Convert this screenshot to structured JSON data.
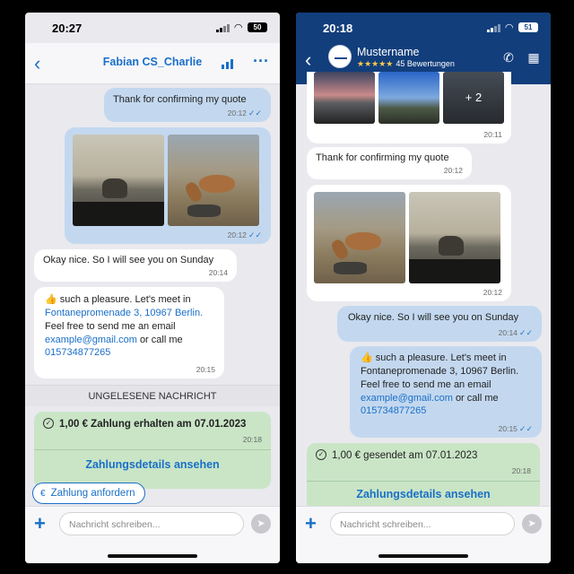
{
  "left": {
    "status_time": "20:27",
    "battery": "50",
    "header": {
      "title": "Fabian CS_Charlie"
    },
    "messages": {
      "m1": {
        "text": "Thank for confirming my quote",
        "time": "20:12"
      },
      "photos_time": "20:12",
      "m2": {
        "text": "Okay nice. So I will see you on Sunday",
        "time": "20:14"
      },
      "m3": {
        "emoji": "👍",
        "line1": "such a pleasure. Let's meet in",
        "address": "Fontanepromenade 3, 10967 Berlin.",
        "line2": "Feel free to send me an email",
        "email": "example@gmail.com",
        "or_call": "or call me",
        "phone": "015734877265",
        "time": "20:15"
      }
    },
    "unread_label": "UNGELESENE NACHRICHT",
    "payment": {
      "title": "1,00 € Zahlung erhalten am 07.01.2023",
      "time": "20:18",
      "link": "Zahlungsdetails ansehen"
    },
    "request_button": {
      "symbol": "€",
      "label": "Zahlung anfordern"
    },
    "composer": {
      "placeholder": "Nachricht schreiben..."
    }
  },
  "right": {
    "status_time": "20:18",
    "battery": "51",
    "header": {
      "name": "Mustername",
      "stars": "★★★★★",
      "reviews": "45 Bewertungen"
    },
    "messages": {
      "gallery": {
        "more": "+ 2",
        "time": "20:11"
      },
      "m1": {
        "text": "Thank for confirming my quote",
        "time": "20:12"
      },
      "photos_time": "20:12",
      "m2": {
        "text": "Okay nice. So I will see you on Sunday",
        "time": "20:14"
      },
      "m3": {
        "emoji": "👍",
        "line1": "such a pleasure. Let's meet in",
        "address": "Fontanepromenade 3, 10967 Berlin.",
        "line2": "Feel free to send me an email",
        "email": "example@gmail.com",
        "or_call": "or call me",
        "phone": "015734877265",
        "time": "20:15"
      }
    },
    "payment": {
      "title": "1,00 € gesendet am 07.01.2023",
      "time": "20:18",
      "link": "Zahlungsdetails ansehen"
    },
    "composer": {
      "placeholder": "Nachricht schreiben..."
    }
  },
  "colors": {
    "accent": "#1a6fc8",
    "header_dark": "#123e7c",
    "bubble_out": "#c3d8ef",
    "bubble_in": "#ffffff",
    "payment_card": "#c9e5c6"
  }
}
